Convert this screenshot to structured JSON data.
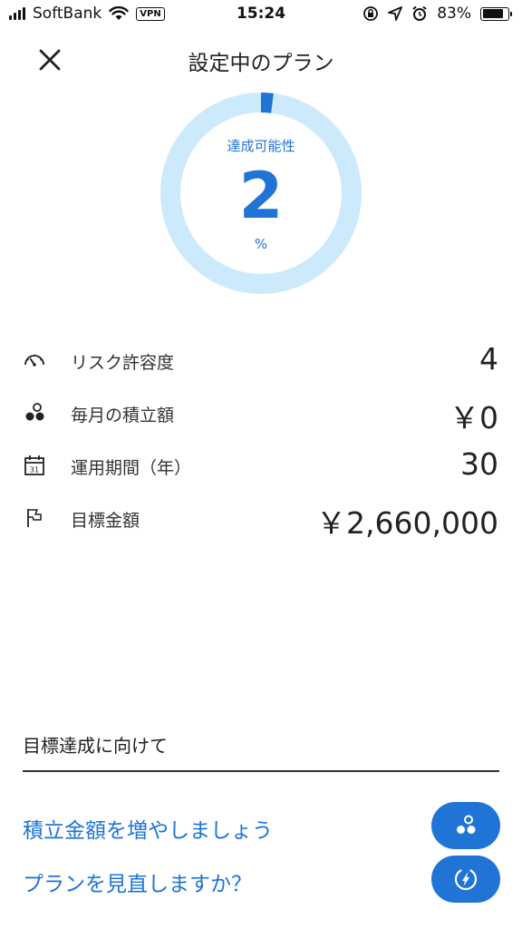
{
  "status_bar": {
    "carrier": "SoftBank",
    "vpn": "VPN",
    "time": "15:24",
    "battery": "83%",
    "battery_level": 0.83
  },
  "header": {
    "title": "設定中のプラン",
    "close_icon": "close-icon"
  },
  "achievement": {
    "label": "達成可能性",
    "value": "2",
    "unit": "%",
    "percent": 2,
    "ring_color": "#cdeafc",
    "progress_color": "#1f74d6"
  },
  "plan_rows": [
    {
      "icon": "gauge-icon",
      "label": "リスク許容度",
      "value": "4"
    },
    {
      "icon": "coins-icon",
      "label": "毎月の積立額",
      "value": "￥0"
    },
    {
      "icon": "calendar-icon",
      "label": "運用期間（年）",
      "value": "30"
    },
    {
      "icon": "flag-icon",
      "label": "目標金額",
      "value": "￥2,660,000"
    }
  ],
  "recommendations": {
    "title": "目標達成に向けて",
    "actions": [
      {
        "label": "積立金額を増やしましょう",
        "icon": "coins-icon"
      },
      {
        "label": "プランを見直しますか？",
        "icon": "compass-icon"
      }
    ]
  },
  "colors": {
    "accent": "#1f74d6",
    "ring": "#cdeafc"
  }
}
